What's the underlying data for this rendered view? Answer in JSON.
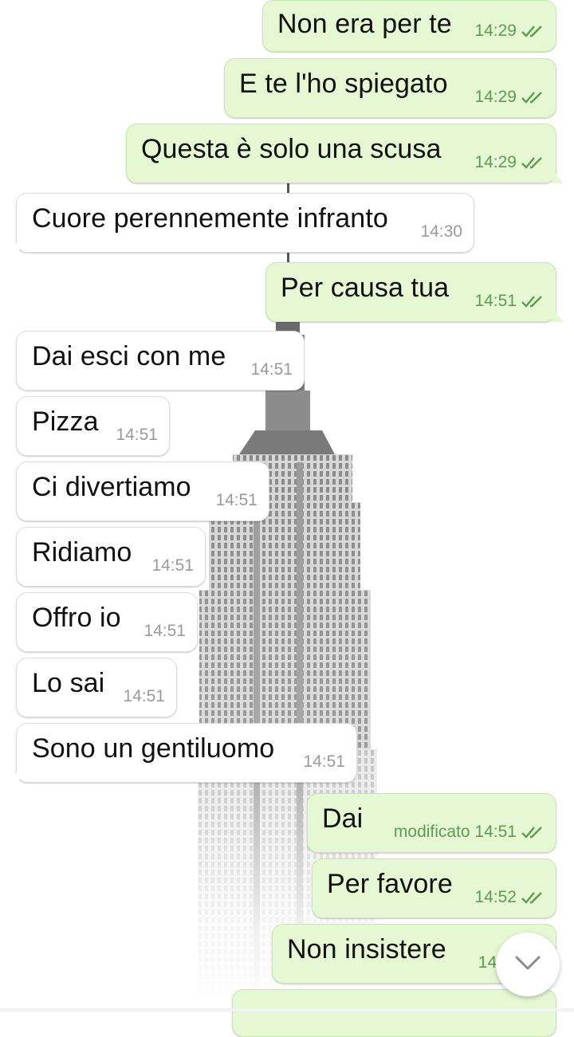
{
  "colors": {
    "outgoing_bubble": "#e5f8d3",
    "incoming_bubble": "#ffffff",
    "outgoing_time": "#5b9b53",
    "incoming_time": "#9a9a9a",
    "read_ticks": "#5b9b53"
  },
  "messages": [
    {
      "direction": "out",
      "text": "Non era per te",
      "time": "14:29",
      "status": "read-double-check-icon"
    },
    {
      "direction": "out",
      "text": "E te l'ho spiegato",
      "time": "14:29",
      "status": "read-double-check-icon"
    },
    {
      "direction": "out",
      "text": "Questa è solo una scusa",
      "time": "14:29",
      "status": "read-double-check-icon"
    },
    {
      "direction": "in",
      "text": "Cuore perennemente infranto",
      "time": "14:30"
    },
    {
      "direction": "out",
      "text": "Per causa tua",
      "time": "14:51",
      "status": "read-double-check-icon"
    },
    {
      "direction": "in",
      "text": "Dai esci con me",
      "time": "14:51"
    },
    {
      "direction": "in",
      "text": "Pizza",
      "time": "14:51"
    },
    {
      "direction": "in",
      "text": "Ci divertiamo",
      "time": "14:51"
    },
    {
      "direction": "in",
      "text": "Ridiamo",
      "time": "14:51"
    },
    {
      "direction": "in",
      "text": "Offro io",
      "time": "14:51"
    },
    {
      "direction": "in",
      "text": "Lo sai",
      "time": "14:51"
    },
    {
      "direction": "in",
      "text": "Sono un gentiluomo",
      "time": "14:51"
    },
    {
      "direction": "out",
      "text": "Dai",
      "time": "modificato 14:51",
      "status": "read-double-check-icon"
    },
    {
      "direction": "out",
      "text": "Per favore",
      "time": "14:52",
      "status": "read-double-check-icon"
    },
    {
      "direction": "out",
      "text": "Non insistere",
      "time": "14:",
      "status": "partially-hidden"
    },
    {
      "direction": "out",
      "text": "",
      "time": "",
      "status": "cut-off"
    }
  ],
  "scroll_button": {
    "icon": "chevron-down-icon"
  }
}
